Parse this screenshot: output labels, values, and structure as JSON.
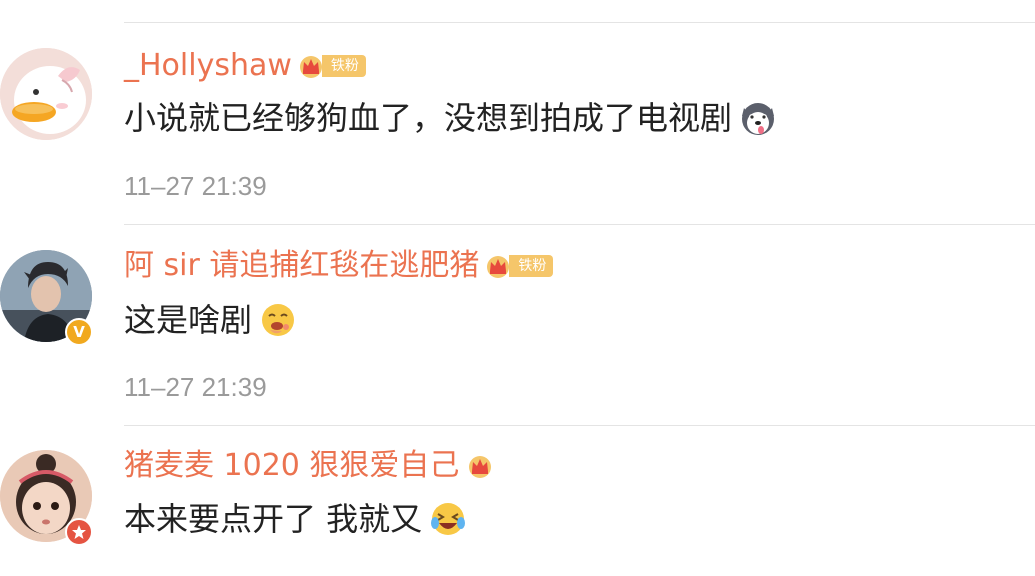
{
  "comments": [
    {
      "username": "_Hollyshaw",
      "fan_label": "铁粉",
      "text": "小说就已经够狗血了，没想到拍成了电视剧",
      "emoji": "husky-dog-icon",
      "time": "11–27 21:39"
    },
    {
      "username": "阿 sir 请追捕红毯在逃肥猪",
      "fan_label": "铁粉",
      "text": "这是啥剧",
      "emoji": "drooling-face-icon",
      "time": "11–27 21:39",
      "verified_badge": "V"
    },
    {
      "username": "猪麦麦 1020 狠狠爱自己",
      "text": "本来要点开了 我就又",
      "emoji": "laughing-tears-icon"
    }
  ],
  "colors": {
    "username": "#eb7350",
    "fan_tag": "#f5c66a",
    "timestamp": "#9a9a9a",
    "verify_yellow": "#f1a91f",
    "verify_red": "#e55442"
  }
}
